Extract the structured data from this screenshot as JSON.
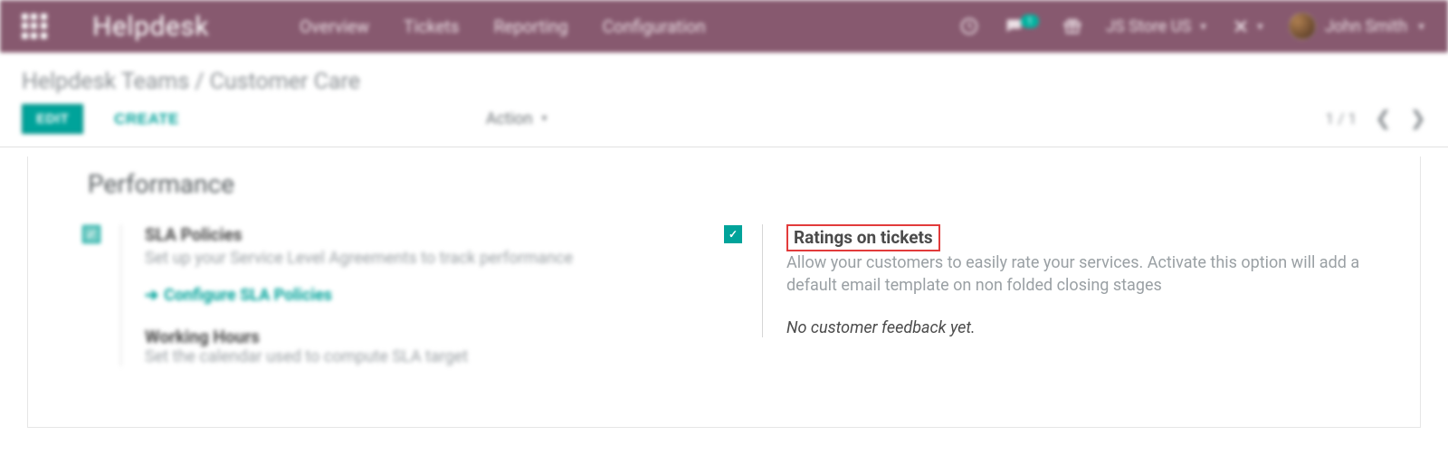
{
  "header": {
    "brand": "Helpdesk",
    "menu": [
      "Overview",
      "Tickets",
      "Reporting",
      "Configuration"
    ],
    "chat_badge": "1",
    "company": "JS Store US",
    "user": "John Smith"
  },
  "breadcrumb": {
    "parent": "Helpdesk Teams",
    "sep": "/",
    "current": "Customer Care"
  },
  "actions": {
    "edit": "EDIT",
    "create": "CREATE",
    "action_menu": "Action"
  },
  "pager": {
    "range": "1 / 1"
  },
  "section": {
    "title": "Performance",
    "left": {
      "sla_title": "SLA Policies",
      "sla_desc": "Set up your Service Level Agreements to track performance",
      "sla_link": "Configure SLA Policies",
      "wh_title": "Working Hours",
      "wh_desc": "Set the calendar used to compute SLA target"
    },
    "right": {
      "ratings_title": "Ratings on tickets",
      "ratings_desc": "Allow your customers to easily rate your services. Activate this option will add a default email template on non folded closing stages",
      "feedback_empty": "No customer feedback yet."
    }
  }
}
